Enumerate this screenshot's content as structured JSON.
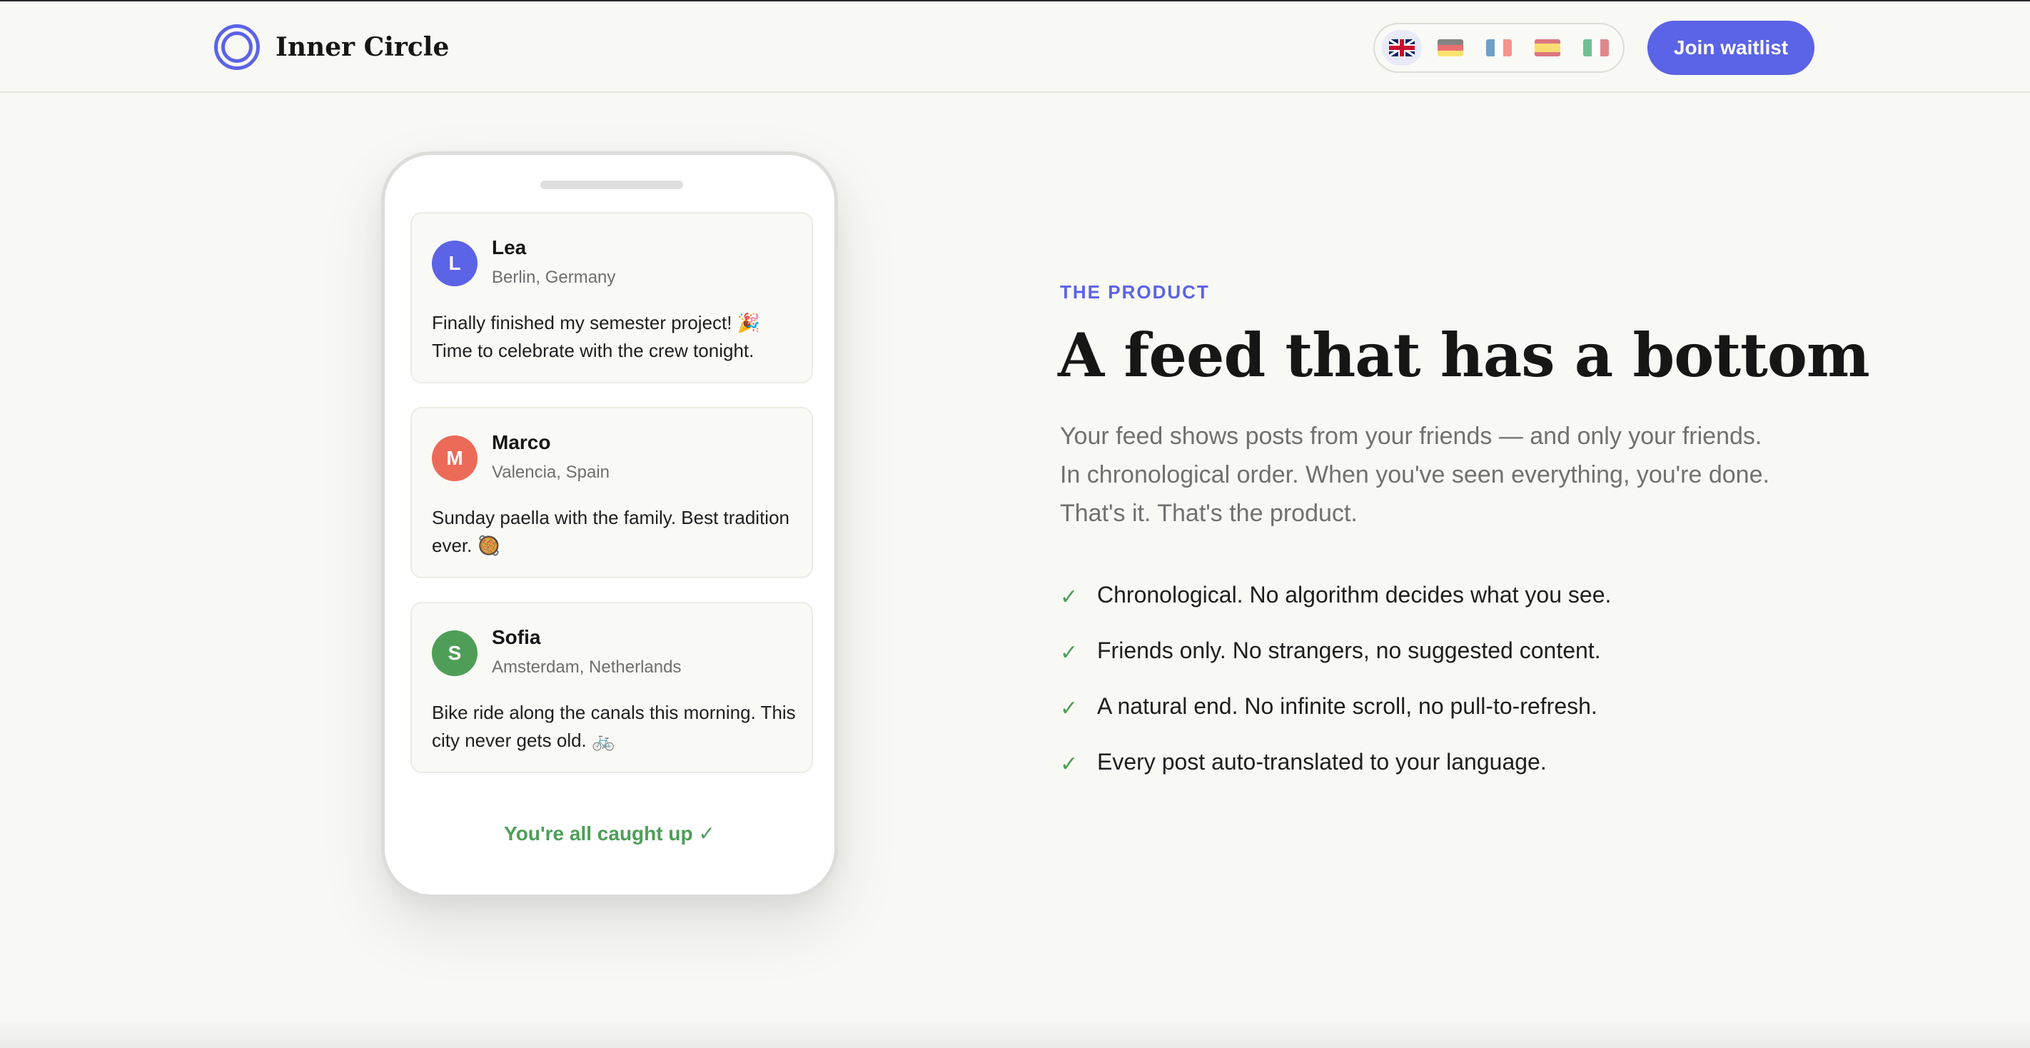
{
  "header": {
    "brand": "Inner Circle",
    "cta_label": "Join waitlist",
    "languages": [
      {
        "code": "en",
        "icon": "uk-flag-icon",
        "active": true
      },
      {
        "code": "de",
        "icon": "germany-flag-icon",
        "active": false
      },
      {
        "code": "fr",
        "icon": "france-flag-icon",
        "active": false
      },
      {
        "code": "es",
        "icon": "spain-flag-icon",
        "active": false
      },
      {
        "code": "it",
        "icon": "italy-flag-icon",
        "active": false
      }
    ]
  },
  "phone": {
    "posts": [
      {
        "initial": "L",
        "name": "Lea",
        "location": "Berlin, Germany",
        "text": "Finally finished my semester project! 🎉 Time to celebrate with the crew tonight.",
        "avatar_color": "#5b63e6"
      },
      {
        "initial": "M",
        "name": "Marco",
        "location": "Valencia, Spain",
        "text": "Sunday paella with the family. Best tradition ever. 🥘",
        "avatar_color": "#ec6b58"
      },
      {
        "initial": "S",
        "name": "Sofia",
        "location": "Amsterdam, Netherlands",
        "text": "Bike ride along the canals this morning. This city never gets old. 🚲",
        "avatar_color": "#4f9e58"
      }
    ],
    "caught_up": "You're all caught up ✓"
  },
  "product": {
    "eyebrow": "THE PRODUCT",
    "headline": "A feed that has a bottom",
    "lead": "Your feed shows posts from your friends — and only your friends. In chronological order. When you've seen everything, you're done. That's it. That's the product.",
    "features": [
      {
        "icon": "check-icon",
        "text": "Chronological. No algorithm decides what you see."
      },
      {
        "icon": "check-icon",
        "text": "Friends only. No strangers, no suggested content."
      },
      {
        "icon": "check-icon",
        "text": "A natural end. No infinite scroll, no pull-to-refresh."
      },
      {
        "icon": "check-icon",
        "text": "Every post auto-translated to your language."
      }
    ]
  },
  "colors": {
    "accent": "#5b63e6",
    "success": "#4d9e57",
    "background": "#f8f8f4"
  }
}
